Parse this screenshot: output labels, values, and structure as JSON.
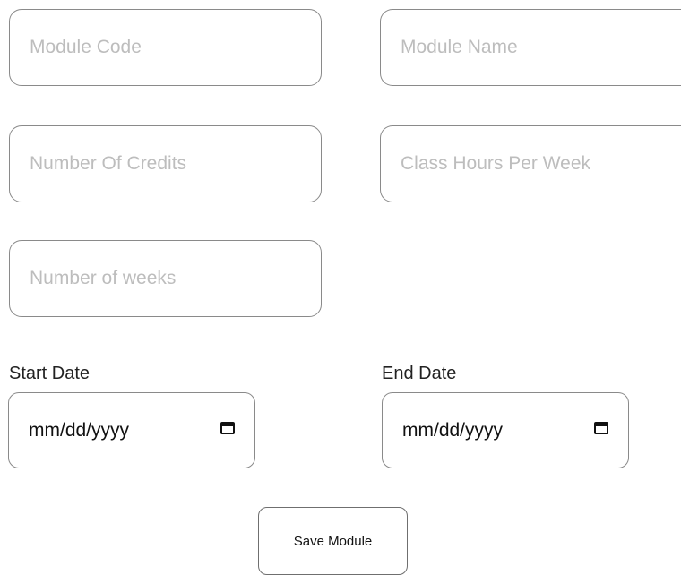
{
  "form": {
    "module_code": {
      "placeholder": "Module Code",
      "value": ""
    },
    "module_name": {
      "placeholder": "Module Name",
      "value": ""
    },
    "number_of_credits": {
      "placeholder": "Number Of Credits",
      "value": ""
    },
    "class_hours_per_week": {
      "placeholder": "Class Hours Per Week",
      "value": ""
    },
    "number_of_weeks": {
      "placeholder": "Number of weeks",
      "value": ""
    },
    "start_date": {
      "label": "Start Date",
      "placeholder": "mm/dd/yyyy"
    },
    "end_date": {
      "label": "End Date",
      "placeholder": "mm/dd/yyyy"
    },
    "save_label": "Save Module"
  },
  "icons": {
    "start_date_picker": "calendar-icon",
    "end_date_picker": "calendar-icon"
  }
}
